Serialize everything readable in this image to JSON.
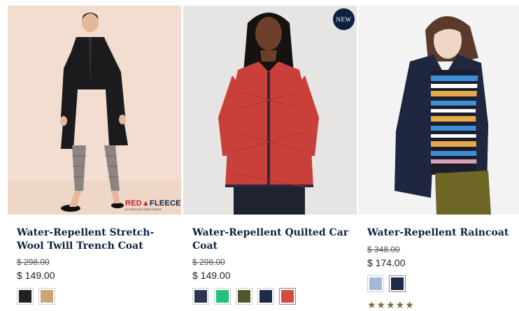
{
  "products": [
    {
      "title": "Water-Repellent Stretch-Wool Twill Trench Coat",
      "original_price": "$ 298.00",
      "sale_price": "$ 149.00",
      "brand_logo": {
        "primary": "RED",
        "secondary": "FLEECE",
        "tagline": "BY BROOKS BROTHERS"
      },
      "swatches": [
        {
          "color": "black",
          "hex": "#222222"
        },
        {
          "color": "camel",
          "hex": "#c9a577"
        }
      ]
    },
    {
      "title": "Water-Repellent Quilted Car Coat",
      "badge": "NEW",
      "original_price": "$ 298.00",
      "sale_price": "$ 149.00",
      "swatches": [
        {
          "color": "navy-quilt",
          "hex": "#2c3650"
        },
        {
          "color": "green",
          "hex": "#1fc47a"
        },
        {
          "color": "olive",
          "hex": "#4f5a2c"
        },
        {
          "color": "navy",
          "hex": "#1e2a4a"
        },
        {
          "color": "red",
          "hex": "#d94a3e"
        }
      ]
    },
    {
      "title": "Water-Repellent Raincoat",
      "original_price": "$ 348.00",
      "sale_price": "$ 174.00",
      "swatches": [
        {
          "color": "light-blue",
          "hex": "#a5b8da"
        },
        {
          "color": "navy",
          "hex": "#1e2a4a"
        }
      ],
      "rating_stars": "★★★★★"
    }
  ],
  "colors": {
    "title": "#0d2240",
    "price": "#222222",
    "badge_bg": "#0d2240",
    "stars": "#7a6b3a"
  }
}
